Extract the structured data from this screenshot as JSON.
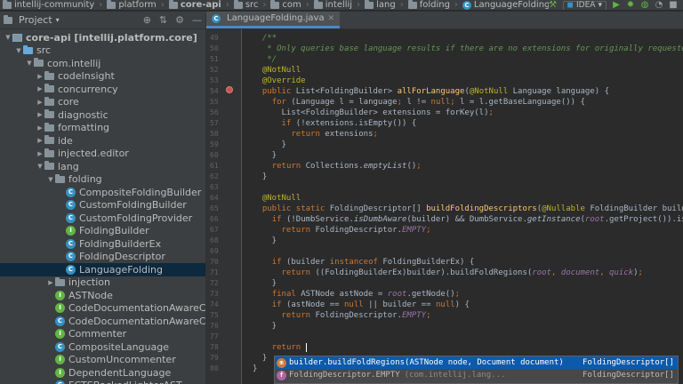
{
  "navbar": {
    "crumbs": [
      "intellij-community",
      "platform",
      "core-api",
      "src",
      "com",
      "intellij",
      "lang",
      "folding",
      "LanguageFolding"
    ],
    "run_config": "IDEA"
  },
  "project_panel": {
    "title": "Project",
    "tree": [
      {
        "label": "core-api [intellij.platform.core]",
        "level": 1,
        "kind": "module",
        "arrow": "▼"
      },
      {
        "label": "src",
        "level": 2,
        "kind": "srcfolder",
        "arrow": "▼"
      },
      {
        "label": "com.intellij",
        "level": 3,
        "kind": "package",
        "arrow": "▼"
      },
      {
        "label": "codeInsight",
        "level": 4,
        "kind": "package",
        "arrow": "▶"
      },
      {
        "label": "concurrency",
        "level": 4,
        "kind": "package",
        "arrow": "▶"
      },
      {
        "label": "core",
        "level": 4,
        "kind": "package",
        "arrow": "▶"
      },
      {
        "label": "diagnostic",
        "level": 4,
        "kind": "package",
        "arrow": "▶"
      },
      {
        "label": "formatting",
        "level": 4,
        "kind": "package",
        "arrow": "▶"
      },
      {
        "label": "ide",
        "level": 4,
        "kind": "package",
        "arrow": "▶"
      },
      {
        "label": "injected.editor",
        "level": 4,
        "kind": "package",
        "arrow": "▶"
      },
      {
        "label": "lang",
        "level": 4,
        "kind": "package",
        "arrow": "▼"
      },
      {
        "label": "folding",
        "level": 5,
        "kind": "package",
        "arrow": "▼"
      },
      {
        "label": "CompositeFoldingBuilder",
        "level": 6,
        "kind": "class",
        "arrow": ""
      },
      {
        "label": "CustomFoldingBuilder",
        "level": 6,
        "kind": "class",
        "arrow": ""
      },
      {
        "label": "CustomFoldingProvider",
        "level": 6,
        "kind": "class",
        "arrow": ""
      },
      {
        "label": "FoldingBuilder",
        "level": 6,
        "kind": "interface",
        "arrow": ""
      },
      {
        "label": "FoldingBuilderEx",
        "level": 6,
        "kind": "class",
        "arrow": ""
      },
      {
        "label": "FoldingDescriptor",
        "level": 6,
        "kind": "class",
        "arrow": ""
      },
      {
        "label": "LanguageFolding",
        "level": 6,
        "kind": "class",
        "arrow": "",
        "selected": true
      },
      {
        "label": "injection",
        "level": 5,
        "kind": "package",
        "arrow": "▶"
      },
      {
        "label": "ASTNode",
        "level": 5,
        "kind": "interface",
        "arrow": ""
      },
      {
        "label": "CodeDocumentationAwareCo",
        "level": 5,
        "kind": "interface",
        "arrow": ""
      },
      {
        "label": "CodeDocumentationAwareCo",
        "level": 5,
        "kind": "class",
        "arrow": ""
      },
      {
        "label": "Commenter",
        "level": 5,
        "kind": "interface",
        "arrow": ""
      },
      {
        "label": "CompositeLanguage",
        "level": 5,
        "kind": "class",
        "arrow": ""
      },
      {
        "label": "CustomUncommenter",
        "level": 5,
        "kind": "interface",
        "arrow": ""
      },
      {
        "label": "DependentLanguage",
        "level": 5,
        "kind": "interface",
        "arrow": ""
      },
      {
        "label": "FCTSBackedLighterAST",
        "level": 5,
        "kind": "class",
        "arrow": ""
      }
    ]
  },
  "editor": {
    "tab_label": "LanguageFolding.java",
    "line_numbers": [
      "49",
      "50",
      "51",
      "52",
      "53",
      "54",
      "55",
      "56",
      "57",
      "58",
      "59",
      "60",
      "61",
      "62",
      "63",
      "64",
      "65",
      "66",
      "67",
      "68",
      "69",
      "70",
      "71",
      "72",
      "73",
      "74",
      "75",
      "76",
      "77",
      "78",
      "79",
      "80"
    ],
    "completion": [
      {
        "text": "builder.buildFoldRegions(ASTNode node, Document document)",
        "type": "FoldingDescriptor[]",
        "selected": true
      },
      {
        "text": "FoldingDescriptor.EMPTY",
        "hint": "(com.intellij.lang...",
        "type": "FoldingDescriptor[]",
        "selected": false
      }
    ]
  },
  "colors": {
    "background": "#2b2b2b",
    "panel": "#3c3f41",
    "keyword": "#cc7832",
    "annotation": "#bbb529",
    "comment": "#629755",
    "method": "#ffc66d",
    "selection": "#0d5aad"
  }
}
